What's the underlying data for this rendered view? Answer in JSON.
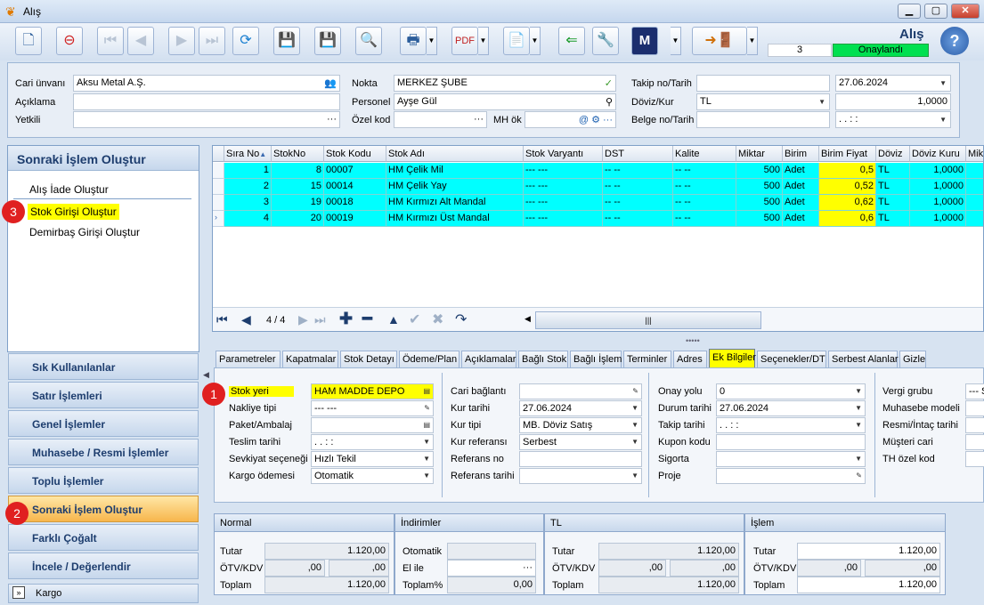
{
  "window": {
    "title": "Alış"
  },
  "toolbar": {
    "title": "Alış",
    "record_no": "3",
    "status": "Onaylandı"
  },
  "header": {
    "cari_unvani": {
      "label": "Cari ünvanı",
      "value": "Aksu Metal A.Ş."
    },
    "aciklama": {
      "label": "Açıklama",
      "value": ""
    },
    "yetkili": {
      "label": "Yetkili",
      "value": ""
    },
    "nokta": {
      "label": "Nokta",
      "value": "MERKEZ ŞUBE"
    },
    "personel": {
      "label": "Personel",
      "value": "Ayşe Gül"
    },
    "ozel_kod": {
      "label": "Özel kod",
      "value": ""
    },
    "mh_ok": {
      "label": "MH ök",
      "value": ""
    },
    "takip": {
      "label": "Takip no/Tarih",
      "no": "",
      "date": "27.06.2024"
    },
    "doviz": {
      "label": "Döviz/Kur",
      "currency": "TL",
      "rate": "1,0000"
    },
    "belge": {
      "label": "Belge no/Tarih",
      "no": "",
      "date": ". .   : :"
    }
  },
  "sidebar": {
    "title": "Sonraki İşlem Oluştur",
    "items": [
      {
        "label": "Alış İade Oluştur"
      },
      {
        "label": "Stok Girişi Oluştur"
      },
      {
        "label": "Demirbaş Girişi Oluştur"
      }
    ],
    "groups": [
      {
        "label": "Sık Kullanılanlar"
      },
      {
        "label": "Satır İşlemleri"
      },
      {
        "label": "Genel İşlemler"
      },
      {
        "label": "Muhasebe / Resmi İşlemler"
      },
      {
        "label": "Toplu İşlemler"
      },
      {
        "label": "Sonraki İşlem Oluştur"
      },
      {
        "label": "Farklı Çoğalt"
      },
      {
        "label": "İncele / Değerlendir"
      }
    ],
    "footer": "Kargo",
    "badges": [
      "1",
      "2",
      "3"
    ]
  },
  "grid": {
    "columns": [
      "Sıra No",
      "StokNo",
      "Stok Kodu",
      "Stok Adı",
      "Stok Varyantı",
      "DST",
      "Kalite",
      "Miktar",
      "Birim",
      "Birim Fiyat",
      "Döviz",
      "Döviz Kuru",
      "Mik"
    ],
    "rows": [
      {
        "sira": "1",
        "stokno": "8",
        "kod": "00007",
        "ad": "HM Çelik Mil",
        "varyant": "--- ---",
        "dst": "-- --",
        "kalite": "-- --",
        "miktar": "500",
        "birim": "Adet",
        "fiyat": "0,5",
        "doviz": "TL",
        "kur": "1,0000"
      },
      {
        "sira": "2",
        "stokno": "15",
        "kod": "00014",
        "ad": "HM Çelik Yay",
        "varyant": "--- ---",
        "dst": "-- --",
        "kalite": "-- --",
        "miktar": "500",
        "birim": "Adet",
        "fiyat": "0,52",
        "doviz": "TL",
        "kur": "1,0000"
      },
      {
        "sira": "3",
        "stokno": "19",
        "kod": "00018",
        "ad": "HM Kırmızı Alt Mandal",
        "varyant": "--- ---",
        "dst": "-- --",
        "kalite": "-- --",
        "miktar": "500",
        "birim": "Adet",
        "fiyat": "0,62",
        "doviz": "TL",
        "kur": "1,0000"
      },
      {
        "sira": "4",
        "stokno": "20",
        "kod": "00019",
        "ad": "HM Kırmızı Üst Mandal",
        "varyant": "--- ---",
        "dst": "-- --",
        "kalite": "-- --",
        "miktar": "500",
        "birim": "Adet",
        "fiyat": "0,6",
        "doviz": "TL",
        "kur": "1,0000"
      }
    ],
    "pager": "4 / 4"
  },
  "tabs": [
    "Parametreler",
    "Kapatmalar",
    "Stok Detayı",
    "Ödeme/Plan",
    "Açıklamalar",
    "Bağlı Stok",
    "Bağlı İşlem",
    "Terminler",
    "Adres",
    "Ek Bilgiler",
    "Seçenekler/DT",
    "Serbest Alanlar",
    "Gizle"
  ],
  "ek": {
    "col1": [
      {
        "label": "Stok yeri",
        "value": "HAM MADDE DEPO"
      },
      {
        "label": "Nakliye tipi",
        "value": "--- ---"
      },
      {
        "label": "Paket/Ambalaj",
        "value": ""
      },
      {
        "label": "Teslim tarihi",
        "value": ". .   : :"
      },
      {
        "label": "Sevkiyat seçeneği",
        "value": "Hızlı Tekil"
      },
      {
        "label": "Kargo ödemesi",
        "value": "Otomatik"
      }
    ],
    "col2": [
      {
        "label": "Cari bağlantı",
        "value": ""
      },
      {
        "label": "Kur tarihi",
        "value": "27.06.2024"
      },
      {
        "label": "Kur tipi",
        "value": "MB. Döviz Satış"
      },
      {
        "label": "Kur referansı",
        "value": "Serbest"
      },
      {
        "label": "Referans no",
        "value": ""
      },
      {
        "label": "Referans tarihi",
        "value": ""
      }
    ],
    "col3": [
      {
        "label": "Onay yolu",
        "value": "0"
      },
      {
        "label": "Durum tarihi",
        "value": "27.06.2024"
      },
      {
        "label": "Takip tarihi",
        "value": ". .   : :"
      },
      {
        "label": "Kupon kodu",
        "value": ""
      },
      {
        "label": "Sigorta",
        "value": ""
      },
      {
        "label": "Proje",
        "value": ""
      }
    ],
    "col4": [
      {
        "label": "Vergi grubu",
        "value": "--- S"
      },
      {
        "label": "Muhasebe modeli",
        "value": ""
      },
      {
        "label": "Resmi/İntaç tarihi",
        "value": ""
      },
      {
        "label": "Müşteri cari",
        "value": ""
      },
      {
        "label": "TH özel kod",
        "value": ""
      }
    ]
  },
  "totals": {
    "normal": {
      "title": "Normal",
      "tutar_label": "Tutar",
      "tutar": "1.120,00",
      "otv_label": "ÖTV/KDV",
      "otv": ",00",
      "kdv": ",00",
      "toplam_label": "Toplam",
      "toplam": "1.120,00"
    },
    "indirimler": {
      "title": "İndirimler",
      "otomatik_label": "Otomatik",
      "otomatik": "",
      "elile_label": "El ile",
      "elile": "",
      "toplam_label": "Toplam%",
      "toplam": "0,00"
    },
    "tl": {
      "title": "TL",
      "tutar_label": "Tutar",
      "tutar": "1.120,00",
      "otv_label": "ÖTV/KDV",
      "otv": ",00",
      "kdv": ",00",
      "toplam_label": "Toplam",
      "toplam": "1.120,00"
    },
    "islem": {
      "title": "İşlem",
      "tutar_label": "Tutar",
      "tutar": "1.120,00",
      "otv_label": "ÖTV/KDV",
      "otv": ",00",
      "kdv": ",00",
      "toplam_label": "Toplam",
      "toplam": "1.120,00"
    }
  },
  "colors": {
    "accent_highlight": "#ffff00",
    "row_bg": "#00ffff",
    "status_green": "#00e050",
    "badge_red": "#e02020"
  }
}
